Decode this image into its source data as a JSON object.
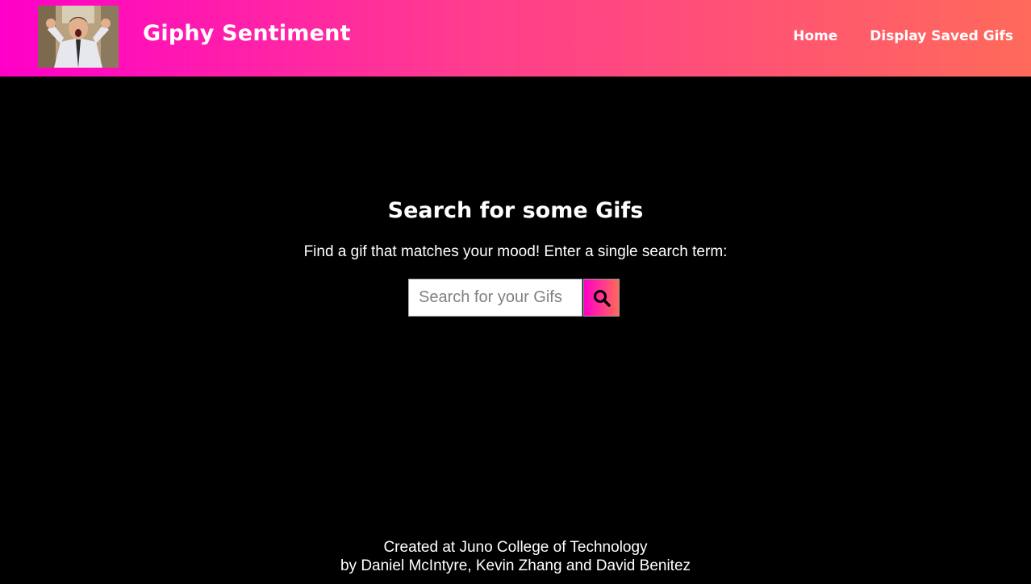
{
  "header": {
    "title": "Giphy Sentiment",
    "nav": [
      {
        "label": "Home"
      },
      {
        "label": "Display Saved Gifs"
      }
    ],
    "logo_icon": "excited-man-gif-thumbnail"
  },
  "main": {
    "heading": "Search for some Gifs",
    "subtitle": "Find a gif that matches your mood! Enter a single search term:",
    "search": {
      "placeholder": "Search for your Gifs",
      "value": "",
      "button_icon": "search-icon"
    }
  },
  "footer": {
    "line1": "Created at Juno College of Technology",
    "line2": "by Daniel McIntyre, Kevin Zhang and David Benitez"
  },
  "colors": {
    "background": "#000000",
    "gradient_start": "#ff00c8",
    "gradient_end": "#ff6a5a",
    "text": "#ffffff"
  }
}
